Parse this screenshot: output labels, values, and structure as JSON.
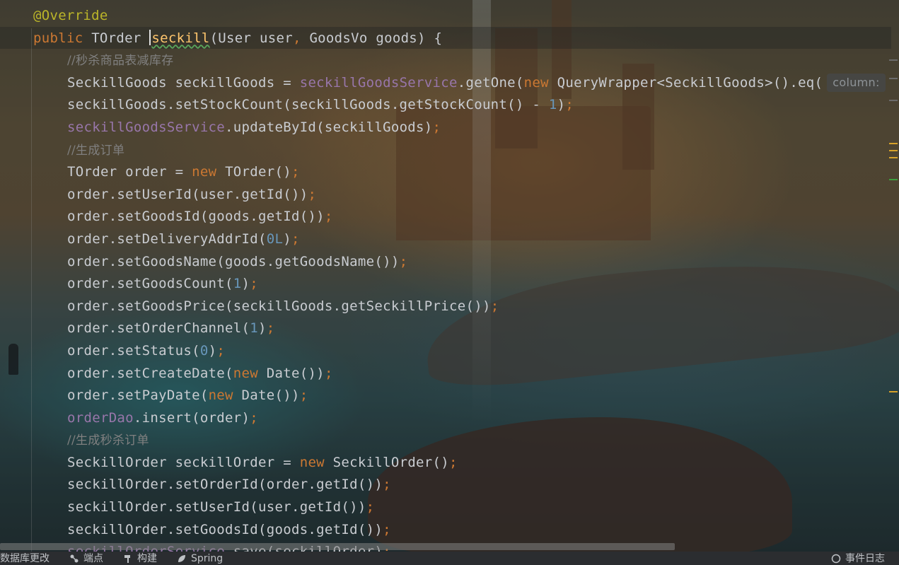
{
  "editor": {
    "lines": [
      {
        "indent": 0,
        "tokens": [
          {
            "t": "@Override",
            "c": "ann"
          }
        ]
      },
      {
        "indent": 0,
        "tokens": [
          {
            "t": "public ",
            "c": "kw"
          },
          {
            "t": "TOrder ",
            "c": "plain"
          },
          {
            "t": "CARET",
            "c": "caret"
          },
          {
            "t": "seckill",
            "c": "fn"
          },
          {
            "t": "(User user",
            "c": "plain"
          },
          {
            "t": ", ",
            "c": "kw"
          },
          {
            "t": "GoodsVo goods) {",
            "c": "plain"
          }
        ]
      },
      {
        "indent": 1,
        "tokens": [
          {
            "t": "//秒杀商品表减库存",
            "c": "cmt"
          }
        ]
      },
      {
        "indent": 1,
        "tokens": [
          {
            "t": "SeckillGoods seckillGoods = ",
            "c": "plain"
          },
          {
            "t": "seckillGoodsService",
            "c": "field"
          },
          {
            "t": ".getOne(",
            "c": "plain"
          },
          {
            "t": "new ",
            "c": "kw"
          },
          {
            "t": "QueryWrapper<SeckillGoods>().eq(",
            "c": "plain"
          },
          {
            "t": "column:",
            "c": "hint"
          }
        ]
      },
      {
        "indent": 1,
        "tokens": [
          {
            "t": "seckillGoods.setStockCount(seckillGoods.getStockCount() - ",
            "c": "plain"
          },
          {
            "t": "1",
            "c": "num"
          },
          {
            "t": ")",
            "c": "plain"
          },
          {
            "t": ";",
            "c": "kw"
          }
        ]
      },
      {
        "indent": 1,
        "tokens": [
          {
            "t": "seckillGoodsService",
            "c": "field"
          },
          {
            "t": ".updateById(seckillGoods)",
            "c": "plain"
          },
          {
            "t": ";",
            "c": "kw"
          }
        ]
      },
      {
        "indent": 1,
        "tokens": [
          {
            "t": "//生成订单",
            "c": "cmt"
          }
        ]
      },
      {
        "indent": 1,
        "tokens": [
          {
            "t": "TOrder order = ",
            "c": "plain"
          },
          {
            "t": "new ",
            "c": "kw"
          },
          {
            "t": "TOrder()",
            "c": "plain"
          },
          {
            "t": ";",
            "c": "kw"
          }
        ]
      },
      {
        "indent": 1,
        "tokens": [
          {
            "t": "order.setUserId(user.getId())",
            "c": "plain"
          },
          {
            "t": ";",
            "c": "kw"
          }
        ]
      },
      {
        "indent": 1,
        "tokens": [
          {
            "t": "order.setGoodsId(goods.getId())",
            "c": "plain"
          },
          {
            "t": ";",
            "c": "kw"
          }
        ]
      },
      {
        "indent": 1,
        "tokens": [
          {
            "t": "order.setDeliveryAddrId(",
            "c": "plain"
          },
          {
            "t": "0L",
            "c": "num"
          },
          {
            "t": ")",
            "c": "plain"
          },
          {
            "t": ";",
            "c": "kw"
          }
        ]
      },
      {
        "indent": 1,
        "tokens": [
          {
            "t": "order.setGoodsName(goods.getGoodsName())",
            "c": "plain"
          },
          {
            "t": ";",
            "c": "kw"
          }
        ]
      },
      {
        "indent": 1,
        "tokens": [
          {
            "t": "order.setGoodsCount(",
            "c": "plain"
          },
          {
            "t": "1",
            "c": "num"
          },
          {
            "t": ")",
            "c": "plain"
          },
          {
            "t": ";",
            "c": "kw"
          }
        ]
      },
      {
        "indent": 1,
        "tokens": [
          {
            "t": "order.setGoodsPrice(seckillGoods.getSeckillPrice())",
            "c": "plain"
          },
          {
            "t": ";",
            "c": "kw"
          }
        ]
      },
      {
        "indent": 1,
        "tokens": [
          {
            "t": "order.setOrderChannel(",
            "c": "plain"
          },
          {
            "t": "1",
            "c": "num"
          },
          {
            "t": ")",
            "c": "plain"
          },
          {
            "t": ";",
            "c": "kw"
          }
        ]
      },
      {
        "indent": 1,
        "tokens": [
          {
            "t": "order.setStatus(",
            "c": "plain"
          },
          {
            "t": "0",
            "c": "num"
          },
          {
            "t": ")",
            "c": "plain"
          },
          {
            "t": ";",
            "c": "kw"
          }
        ]
      },
      {
        "indent": 1,
        "tokens": [
          {
            "t": "order.setCreateDate(",
            "c": "plain"
          },
          {
            "t": "new ",
            "c": "kw"
          },
          {
            "t": "Date())",
            "c": "plain"
          },
          {
            "t": ";",
            "c": "kw"
          }
        ]
      },
      {
        "indent": 1,
        "tokens": [
          {
            "t": "order.setPayDate(",
            "c": "plain"
          },
          {
            "t": "new ",
            "c": "kw"
          },
          {
            "t": "Date())",
            "c": "plain"
          },
          {
            "t": ";",
            "c": "kw"
          }
        ]
      },
      {
        "indent": 1,
        "tokens": [
          {
            "t": "orderDao",
            "c": "field"
          },
          {
            "t": ".insert(order)",
            "c": "plain"
          },
          {
            "t": ";",
            "c": "kw"
          }
        ]
      },
      {
        "indent": 1,
        "tokens": [
          {
            "t": "//生成秒杀订单",
            "c": "cmt"
          }
        ]
      },
      {
        "indent": 1,
        "tokens": [
          {
            "t": "SeckillOrder seckillOrder = ",
            "c": "plain"
          },
          {
            "t": "new ",
            "c": "kw"
          },
          {
            "t": "SeckillOrder()",
            "c": "plain"
          },
          {
            "t": ";",
            "c": "kw"
          }
        ]
      },
      {
        "indent": 1,
        "tokens": [
          {
            "t": "seckillOrder.setOrderId(order.getId())",
            "c": "plain"
          },
          {
            "t": ";",
            "c": "kw"
          }
        ]
      },
      {
        "indent": 1,
        "tokens": [
          {
            "t": "seckillOrder.setUserId(user.getId())",
            "c": "plain"
          },
          {
            "t": ";",
            "c": "kw"
          }
        ]
      },
      {
        "indent": 1,
        "tokens": [
          {
            "t": "seckillOrder.setGoodsId(goods.getId())",
            "c": "plain"
          },
          {
            "t": ";",
            "c": "kw"
          }
        ]
      },
      {
        "indent": 1,
        "tokens": [
          {
            "t": "seckillOrderService",
            "c": "field"
          },
          {
            "t": ".save(seckillOrder)",
            "c": "plain"
          },
          {
            "t": ";",
            "c": "kw"
          }
        ]
      }
    ]
  },
  "statusbar": {
    "items": [
      {
        "label": "数据库更改",
        "icon": "database-icon"
      },
      {
        "label": "端点",
        "icon": "endpoints-icon"
      },
      {
        "label": "构建",
        "icon": "hammer-icon"
      },
      {
        "label": "Spring",
        "icon": "spring-icon"
      }
    ],
    "right_label": "事件日志",
    "right_icon": "event-log-icon"
  },
  "colors": {
    "keyword": "#cc7832",
    "annotation": "#bbb529",
    "method": "#ffc66d",
    "field": "#9876aa",
    "number": "#6897bb",
    "comment": "#808080",
    "text": "#c9ccd1"
  }
}
